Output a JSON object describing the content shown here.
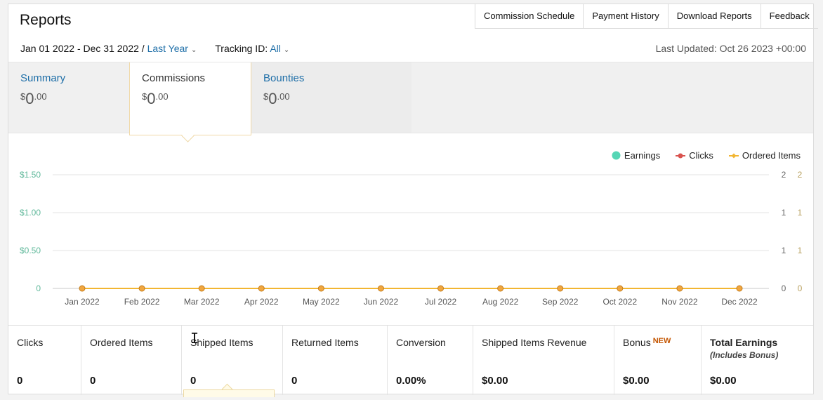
{
  "header": {
    "title": "Reports",
    "links": [
      "Commission Schedule",
      "Payment History",
      "Download Reports",
      "Feedback"
    ],
    "date_range": "Jan 01 2022 - Dec 31 2022 /",
    "period": "Last Year",
    "tracking_label": "Tracking ID:",
    "tracking_value": "All",
    "last_updated": "Last Updated: Oct 26 2023 +00:00"
  },
  "tabs": [
    {
      "label": "Summary",
      "currency": "$",
      "whole": "0",
      "cents": ".00"
    },
    {
      "label": "Commissions",
      "currency": "$",
      "whole": "0",
      "cents": ".00"
    },
    {
      "label": "Bounties",
      "currency": "$",
      "whole": "0",
      "cents": ".00"
    }
  ],
  "legend": [
    {
      "name": "Earnings",
      "color": "#55d6b5"
    },
    {
      "name": "Clicks",
      "color": "#d9534f"
    },
    {
      "name": "Ordered Items",
      "color": "#f2b632"
    }
  ],
  "chart_data": {
    "type": "line",
    "categories": [
      "Jan 2022",
      "Feb 2022",
      "Mar 2022",
      "Apr 2022",
      "May 2022",
      "Jun 2022",
      "Jul 2022",
      "Aug 2022",
      "Sep 2022",
      "Oct 2022",
      "Nov 2022",
      "Dec 2022"
    ],
    "series": [
      {
        "name": "Earnings",
        "color": "#55d6b5",
        "values": [
          0,
          0,
          0,
          0,
          0,
          0,
          0,
          0,
          0,
          0,
          0,
          0
        ]
      },
      {
        "name": "Clicks",
        "color": "#d9534f",
        "values": [
          0,
          0,
          0,
          0,
          0,
          0,
          0,
          0,
          0,
          0,
          0,
          0
        ]
      },
      {
        "name": "Ordered Items",
        "color": "#f2b632",
        "values": [
          0,
          0,
          0,
          0,
          0,
          0,
          0,
          0,
          0,
          0,
          0,
          0
        ]
      }
    ],
    "y_left_ticks": [
      "$1.50",
      "$1.00",
      "$0.50",
      "0"
    ],
    "y_right_ticks_1": [
      "2",
      "1",
      "1",
      "0"
    ],
    "y_right_ticks_2": [
      "2",
      "1",
      "1",
      "0"
    ],
    "ylim": [
      0,
      1.5
    ],
    "left_tick_color": "#5fb89a",
    "right2_tick_color": "#b8a05f",
    "grid": true,
    "legend_position": "top-right"
  },
  "stats": [
    {
      "label": "Clicks",
      "value": "0"
    },
    {
      "label": "Ordered Items",
      "value": "0"
    },
    {
      "label": "Shipped Items",
      "value": "0"
    },
    {
      "label": "Returned Items",
      "value": "0"
    },
    {
      "label": "Conversion",
      "value": "0.00%"
    },
    {
      "label": "Shipped Items Revenue",
      "value": "$0.00"
    },
    {
      "label": "Bonus",
      "badge": "NEW",
      "value": "$0.00"
    },
    {
      "label": "Total Earnings",
      "sub": "(Includes Bonus)",
      "value": "$0.00"
    }
  ]
}
